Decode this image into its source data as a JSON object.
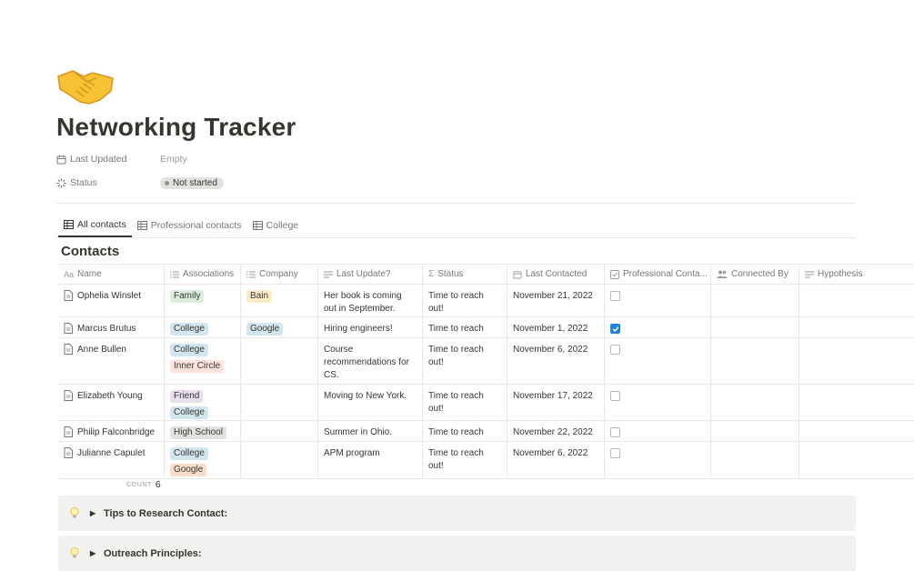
{
  "page": {
    "title": "Networking Tracker",
    "icon": "handshake-icon"
  },
  "properties": [
    {
      "label": "Last Updated",
      "icon": "calendar-icon",
      "value": "Empty",
      "type": "text"
    },
    {
      "label": "Status",
      "icon": "status-loading-icon",
      "value": "Not started",
      "type": "status"
    }
  ],
  "views": [
    {
      "label": "All contacts",
      "icon": "table-icon",
      "active": true
    },
    {
      "label": "Professional contacts",
      "icon": "table-icon",
      "active": false
    },
    {
      "label": "College",
      "icon": "table-icon",
      "active": false
    }
  ],
  "database": {
    "title": "Contacts",
    "columns": [
      {
        "label": "Name",
        "icon": "text-aa-icon"
      },
      {
        "label": "Associations",
        "icon": "multiselect-icon"
      },
      {
        "label": "Company",
        "icon": "multiselect-icon"
      },
      {
        "label": "Last Update?",
        "icon": "text-lines-icon"
      },
      {
        "label": "Status",
        "icon": "sigma-icon"
      },
      {
        "label": "Last Contacted",
        "icon": "calendar-icon"
      },
      {
        "label": "Professional Conta...",
        "icon": "checkbox-icon"
      },
      {
        "label": "Connected By",
        "icon": "people-icon"
      },
      {
        "label": "Hypothesis",
        "icon": "text-lines-icon"
      }
    ],
    "rows": [
      {
        "name": "Ophelia Winslet",
        "associations": [
          {
            "text": "Family",
            "color": "green"
          }
        ],
        "company": [
          {
            "text": "Bain",
            "color": "yellow"
          }
        ],
        "last_update": "Her book is coming out in September.",
        "status": "Time to reach out!",
        "last_contacted": "November 21, 2022",
        "professional": false
      },
      {
        "name": "Marcus Brutus",
        "associations": [
          {
            "text": "College",
            "color": "blue"
          }
        ],
        "company": [
          {
            "text": "Google",
            "color": "blue"
          }
        ],
        "last_update": "Hiring engineers!",
        "status": "Time to reach out!",
        "last_contacted": "November 1, 2022",
        "professional": true
      },
      {
        "name": "Anne Bullen",
        "associations": [
          {
            "text": "College",
            "color": "blue"
          },
          {
            "text": "Inner Circle",
            "color": "red"
          }
        ],
        "company": [],
        "last_update": "Course recommendations for CS.",
        "status": "Time to reach out!",
        "last_contacted": "November 6, 2022",
        "professional": false
      },
      {
        "name": "Elizabeth Young",
        "associations": [
          {
            "text": "Friend",
            "color": "purple"
          },
          {
            "text": "College",
            "color": "blue"
          }
        ],
        "company": [],
        "last_update": "Moving to New York.",
        "status": "Time to reach out!",
        "last_contacted": "November 17, 2022",
        "professional": false
      },
      {
        "name": "Philip Falconbridge",
        "associations": [
          {
            "text": "High School",
            "color": "gray"
          }
        ],
        "company": [],
        "last_update": "Summer in Ohio.",
        "status": "Time to reach out!",
        "last_contacted": "November 22, 2022",
        "professional": false
      },
      {
        "name": "Julianne Capulet",
        "associations": [
          {
            "text": "College",
            "color": "blue"
          },
          {
            "text": "Google",
            "color": "orange"
          }
        ],
        "company": [],
        "last_update": "APM program",
        "status": "Time to reach out!",
        "last_contacted": "November 6, 2022",
        "professional": false
      }
    ],
    "count_label": "COUNT",
    "count_value": "6"
  },
  "callouts": [
    {
      "icon": "lightbulb-icon",
      "text": "Tips to Research Contact:"
    },
    {
      "icon": "lightbulb-icon",
      "text": "Outreach Principles:"
    }
  ],
  "tag_colors": {
    "green": "#dbeddb",
    "yellow": "#fdecc8",
    "blue": "#d3e5ef",
    "red": "#ffe2dd",
    "purple": "#e8deee",
    "gray": "#e3e2e0",
    "orange": "#fadec9"
  }
}
